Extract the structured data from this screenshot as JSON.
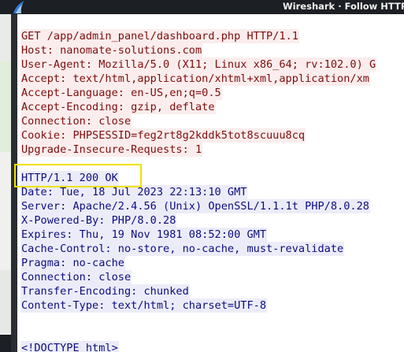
{
  "window": {
    "title": "Wireshark · Follow HTTP Str",
    "icon": "wireshark-fin-icon"
  },
  "stream": {
    "request_lines": [
      "GET /app/admin_panel/dashboard.php HTTP/1.1",
      "Host: nanomate-solutions.com",
      "User-Agent: Mozilla/5.0 (X11; Linux x86_64; rv:102.0) G",
      "Accept: text/html,application/xhtml+xml,application/xm",
      "Accept-Language: en-US,en;q=0.5",
      "Accept-Encoding: gzip, deflate",
      "Connection: close",
      "Cookie: PHPSESSID=feg2rt8g2kddk5tot8scuuu8cq",
      "Upgrade-Insecure-Requests: 1"
    ],
    "response_lines": [
      "HTTP/1.1 200 OK",
      "Date: Tue, 18 Jul 2023 22:13:10 GMT",
      "Server: Apache/2.4.56 (Unix) OpenSSL/1.1.1t PHP/8.0.28",
      "X-Powered-By: PHP/8.0.28",
      "Expires: Thu, 19 Nov 1981 08:52:00 GMT",
      "Cache-Control: no-store, no-cache, must-revalidate",
      "Pragma: no-cache",
      "Connection: close",
      "Transfer-Encoding: chunked",
      "Content-Type: text/html; charset=UTF-8"
    ],
    "body_lines": [
      "<!DOCTYPE html>"
    ]
  },
  "colors": {
    "request_bg": "#fbeded",
    "request_fg": "#7f0d0d",
    "response_bg": "#ececf9",
    "response_fg": "#0d0d7f",
    "annotation_box": "#f0e000"
  }
}
